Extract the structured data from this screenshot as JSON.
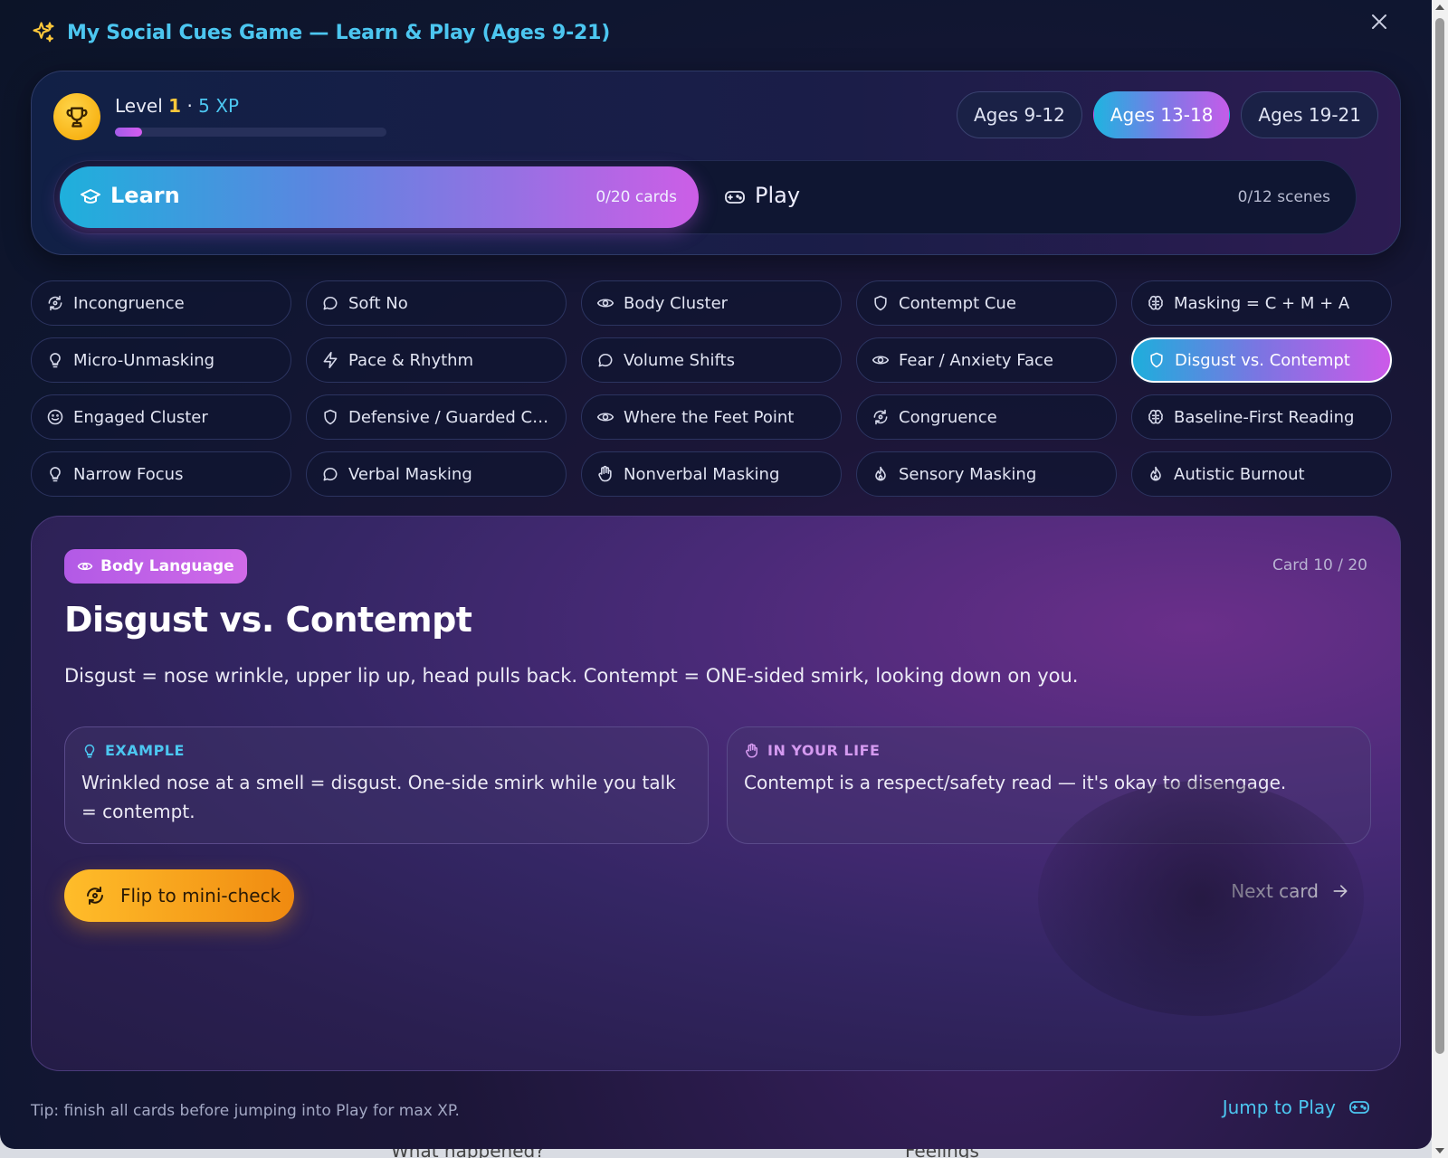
{
  "window": {
    "title": "My Social Cues Game — Learn & Play (Ages 9-21)",
    "close_label": "×"
  },
  "progress": {
    "level_label": "Level",
    "level": "1",
    "separator": "·",
    "xp": "5 XP",
    "xp_fraction": 0.1
  },
  "age_groups": {
    "items": [
      {
        "label": "Ages 9-12",
        "active": false
      },
      {
        "label": "Ages 13-18",
        "active": true
      },
      {
        "label": "Ages 19-21",
        "active": false
      }
    ]
  },
  "modes": {
    "learn": {
      "label": "Learn",
      "count": "0/20 cards",
      "active": true
    },
    "play": {
      "label": "Play",
      "count": "0/12 scenes",
      "active": false
    }
  },
  "topics": [
    {
      "label": "Incongruence",
      "icon": "rotate-icon"
    },
    {
      "label": "Soft No",
      "icon": "chat-icon"
    },
    {
      "label": "Body Cluster",
      "icon": "eye-icon"
    },
    {
      "label": "Contempt Cue",
      "icon": "shield-icon"
    },
    {
      "label": "Masking = C + M + A",
      "icon": "brain-icon"
    },
    {
      "label": "Micro-Unmasking",
      "icon": "lightbulb-icon"
    },
    {
      "label": "Pace & Rhythm",
      "icon": "bolt-icon"
    },
    {
      "label": "Volume Shifts",
      "icon": "chat-icon"
    },
    {
      "label": "Fear / Anxiety Face",
      "icon": "eye-icon"
    },
    {
      "label": "Disgust vs. Contempt",
      "icon": "shield-icon",
      "active": true
    },
    {
      "label": "Engaged Cluster",
      "icon": "smile-icon"
    },
    {
      "label": "Defensive / Guarded Clust...",
      "icon": "shield-icon"
    },
    {
      "label": "Where the Feet Point",
      "icon": "eye-icon"
    },
    {
      "label": "Congruence",
      "icon": "rotate-icon"
    },
    {
      "label": "Baseline-First Reading",
      "icon": "brain-icon"
    },
    {
      "label": "Narrow Focus",
      "icon": "lightbulb-icon"
    },
    {
      "label": "Verbal Masking",
      "icon": "chat-icon"
    },
    {
      "label": "Nonverbal Masking",
      "icon": "hand-icon"
    },
    {
      "label": "Sensory Masking",
      "icon": "flame-icon"
    },
    {
      "label": "Autistic Burnout",
      "icon": "flame-icon"
    }
  ],
  "card": {
    "category": "Body Language",
    "counter": "Card 10 / 20",
    "title": "Disgust vs. Contempt",
    "description": "Disgust = nose wrinkle, upper lip up, head pulls back. Contempt = ONE-sided smirk, looking down on you.",
    "example_heading": "EXAMPLE",
    "example_text": "Wrinkled nose at a smell = disgust. One-side smirk while you talk = contempt.",
    "life_heading": "IN YOUR LIFE",
    "life_text": "Contempt is a respect/safety read — it's okay to disengage.",
    "flip_label": "Flip to mini-check",
    "next_label": "Next card"
  },
  "footer": {
    "tip": "Tip: finish all cards before jumping into Play for max XP.",
    "jump_label": "Jump to Play"
  },
  "background_page": {
    "text_1": "What happened?",
    "text_2": "Feelings"
  },
  "colors": {
    "accent_cyan": "#4cc6f0",
    "accent_magenta": "#cc5ee6",
    "gold": "#ffc83a",
    "orange_button": "#f5a51a"
  }
}
